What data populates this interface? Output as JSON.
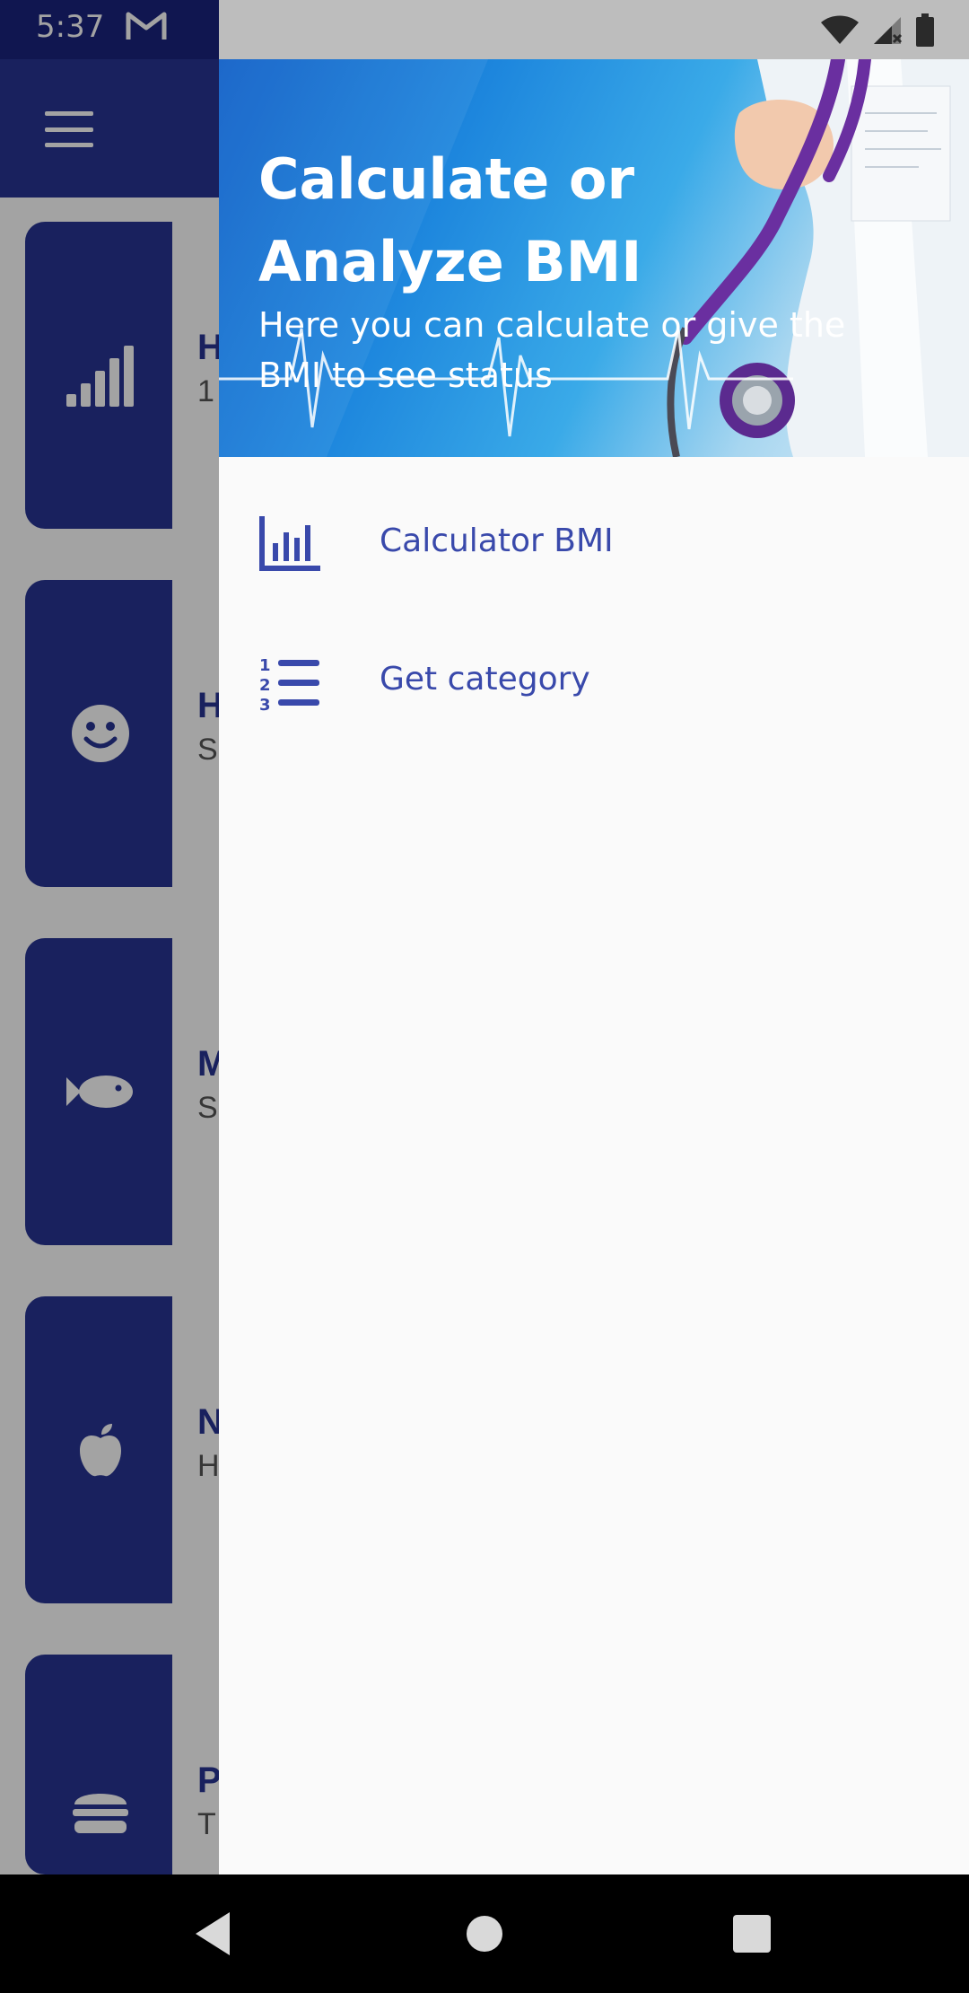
{
  "status_bar": {
    "time": "5:37"
  },
  "background": {
    "cards": [
      {
        "icon": "signal-bars-icon",
        "title": "H",
        "subtitle": "1"
      },
      {
        "icon": "smiley-icon",
        "title": "H",
        "subtitle": "S"
      },
      {
        "icon": "fish-icon",
        "title": "M",
        "subtitle": "S"
      },
      {
        "icon": "apple-icon",
        "title": "N",
        "subtitle": "H"
      },
      {
        "icon": "burger-icon",
        "title": "P",
        "subtitle": "T"
      }
    ]
  },
  "drawer": {
    "header": {
      "title": "Calculate or Analyze BMI",
      "subtitle": "Here you can calculate or give the BMI to see status"
    },
    "items": [
      {
        "label": "Calculator BMI",
        "icon": "bar-chart-icon"
      },
      {
        "label": "Get category",
        "icon": "numbered-list-icon"
      }
    ]
  },
  "colors": {
    "primary": "#283593",
    "accent": "#3949ab",
    "drawer_bg": "#fafafa"
  }
}
